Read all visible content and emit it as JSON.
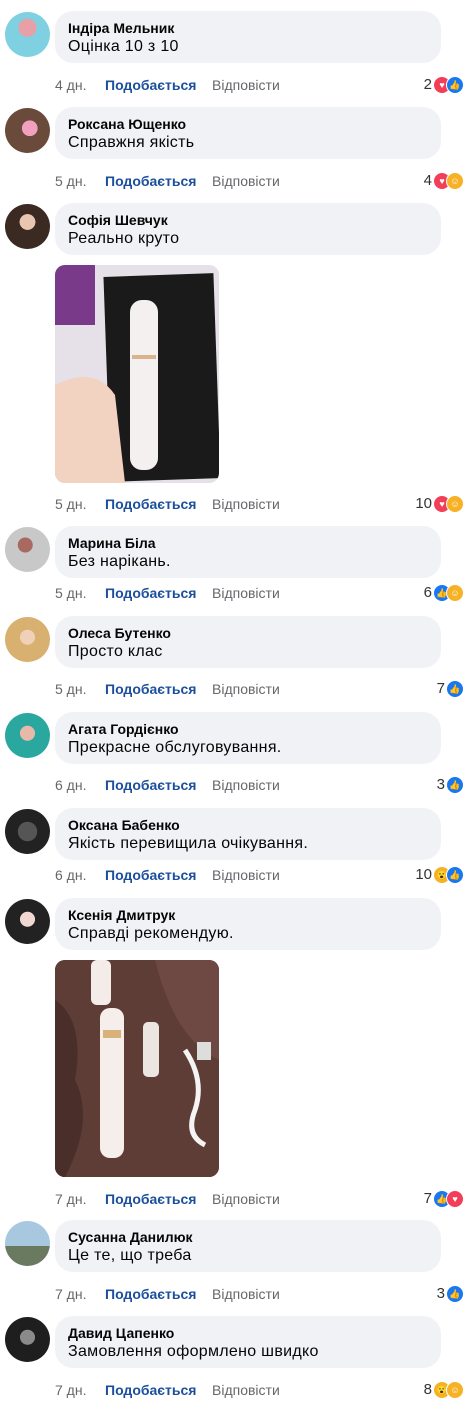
{
  "actions": {
    "like": "Подобається",
    "reply": "Відповісти"
  },
  "icons": {
    "like": "like-icon",
    "heart": "heart-icon",
    "care": "care-icon",
    "wow": "wow-icon"
  },
  "comments": [
    {
      "name": "Індіра Мельник",
      "text": "Оцінка 10 з 10",
      "time": "4 дн.",
      "count": "2"
    },
    {
      "name": "Роксана Ющенко",
      "text": "Справжня якість",
      "time": "5 дн.",
      "count": "4"
    },
    {
      "name": "Софія Шевчук",
      "text": "Реально круто",
      "time": "5 дн.",
      "count": "10"
    },
    {
      "name": "Марина Біла",
      "text": "Без нарікань.",
      "time": "5 дн.",
      "count": "6"
    },
    {
      "name": "Олеса Бутенко",
      "text": "Просто клас",
      "time": "5 дн.",
      "count": "7"
    },
    {
      "name": "Агата Гордієнко",
      "text": "Прекрасне обслуговування.",
      "time": "6 дн.",
      "count": "3"
    },
    {
      "name": "Оксана Бабенко",
      "text": "Якість перевищила очікування.",
      "time": "6 дн.",
      "count": "10"
    },
    {
      "name": "Ксенія Дмитрук",
      "text": "Справді рекомендую.",
      "time": "7 дн.",
      "count": "7"
    },
    {
      "name": "Сусанна Данилюк",
      "text": "Це те, що треба",
      "time": "7 дн.",
      "count": "3"
    },
    {
      "name": "Давид Цапенко",
      "text": "Замовлення оформлено швидко",
      "time": "7 дн.",
      "count": "8"
    }
  ]
}
